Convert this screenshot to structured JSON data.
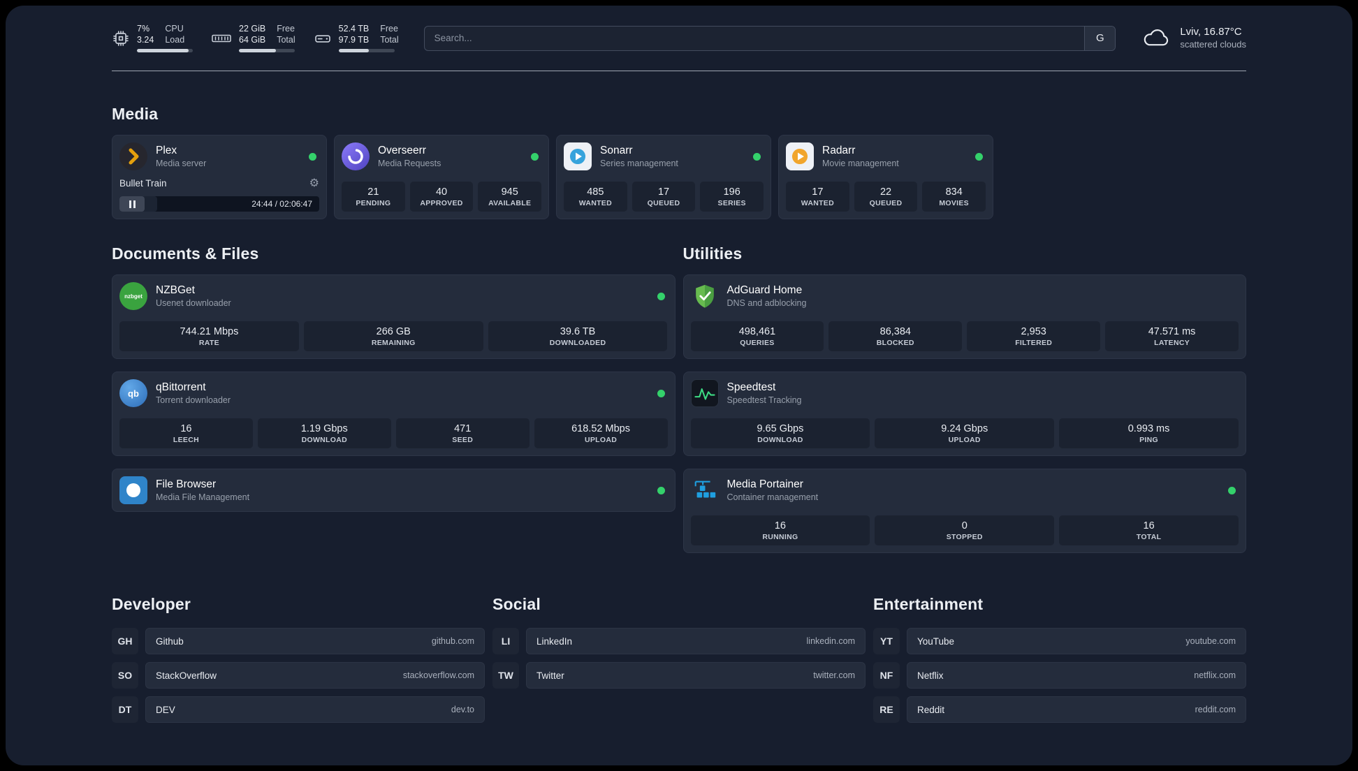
{
  "icons": {
    "gear": "⚙"
  },
  "topbar": {
    "cpu": {
      "value1": "7%",
      "value2": "3.24",
      "label1": "CPU",
      "label2": "Load",
      "bar": 93
    },
    "ram": {
      "value1": "22 GiB",
      "value2": "64 GiB",
      "label1": "Free",
      "label2": "Total",
      "bar": 66
    },
    "disk": {
      "value1": "52.4 TB",
      "value2": "97.9 TB",
      "label1": "Free",
      "label2": "Total",
      "bar": 54
    },
    "search": {
      "placeholder": "Search...",
      "engine_label": "G"
    },
    "weather": {
      "location": "Lviv, 16.87°C",
      "condition": "scattered clouds"
    }
  },
  "sections": {
    "media": {
      "title": "Media",
      "plex": {
        "name": "Plex",
        "subtitle": "Media server",
        "now_playing": "Bullet Train",
        "time": "24:44 / 02:06:47",
        "progress": 19
      },
      "overseerr": {
        "name": "Overseerr",
        "subtitle": "Media Requests",
        "stats": [
          {
            "value": "21",
            "label": "PENDING"
          },
          {
            "value": "40",
            "label": "APPROVED"
          },
          {
            "value": "945",
            "label": "AVAILABLE"
          }
        ]
      },
      "sonarr": {
        "name": "Sonarr",
        "subtitle": "Series management",
        "stats": [
          {
            "value": "485",
            "label": "WANTED"
          },
          {
            "value": "17",
            "label": "QUEUED"
          },
          {
            "value": "196",
            "label": "SERIES"
          }
        ]
      },
      "radarr": {
        "name": "Radarr",
        "subtitle": "Movie management",
        "stats": [
          {
            "value": "17",
            "label": "WANTED"
          },
          {
            "value": "22",
            "label": "QUEUED"
          },
          {
            "value": "834",
            "label": "MOVIES"
          }
        ]
      }
    },
    "documents": {
      "title": "Documents & Files",
      "nzbget": {
        "name": "NZBGet",
        "subtitle": "Usenet downloader",
        "icon_text": "nzbget",
        "stats": [
          {
            "value": "744.21 Mbps",
            "label": "RATE"
          },
          {
            "value": "266 GB",
            "label": "REMAINING"
          },
          {
            "value": "39.6 TB",
            "label": "DOWNLOADED"
          }
        ]
      },
      "qbittorrent": {
        "name": "qBittorrent",
        "subtitle": "Torrent downloader",
        "icon_text": "qb",
        "stats": [
          {
            "value": "16",
            "label": "LEECH"
          },
          {
            "value": "1.19 Gbps",
            "label": "DOWNLOAD"
          },
          {
            "value": "471",
            "label": "SEED"
          },
          {
            "value": "618.52 Mbps",
            "label": "UPLOAD"
          }
        ]
      },
      "filebrowser": {
        "name": "File Browser",
        "subtitle": "Media File Management"
      }
    },
    "utilities": {
      "title": "Utilities",
      "adguard": {
        "name": "AdGuard Home",
        "subtitle": "DNS and adblocking",
        "stats": [
          {
            "value": "498,461",
            "label": "QUERIES"
          },
          {
            "value": "86,384",
            "label": "BLOCKED"
          },
          {
            "value": "2,953",
            "label": "FILTERED"
          },
          {
            "value": "47.571 ms",
            "label": "LATENCY"
          }
        ]
      },
      "speedtest": {
        "name": "Speedtest",
        "subtitle": "Speedtest Tracking",
        "stats": [
          {
            "value": "9.65 Gbps",
            "label": "DOWNLOAD"
          },
          {
            "value": "9.24 Gbps",
            "label": "UPLOAD"
          },
          {
            "value": "0.993 ms",
            "label": "PING"
          }
        ]
      },
      "portainer": {
        "name": "Media Portainer",
        "subtitle": "Container management",
        "stats": [
          {
            "value": "16",
            "label": "RUNNING"
          },
          {
            "value": "0",
            "label": "STOPPED"
          },
          {
            "value": "16",
            "label": "TOTAL"
          }
        ]
      }
    },
    "bookmarks": [
      {
        "title": "Developer",
        "items": [
          {
            "abbr": "GH",
            "name": "Github",
            "url": "github.com"
          },
          {
            "abbr": "SO",
            "name": "StackOverflow",
            "url": "stackoverflow.com"
          },
          {
            "abbr": "DT",
            "name": "DEV",
            "url": "dev.to"
          }
        ]
      },
      {
        "title": "Social",
        "items": [
          {
            "abbr": "LI",
            "name": "LinkedIn",
            "url": "linkedin.com"
          },
          {
            "abbr": "TW",
            "name": "Twitter",
            "url": "twitter.com"
          }
        ]
      },
      {
        "title": "Entertainment",
        "items": [
          {
            "abbr": "YT",
            "name": "YouTube",
            "url": "youtube.com"
          },
          {
            "abbr": "NF",
            "name": "Netflix",
            "url": "netflix.com"
          },
          {
            "abbr": "RE",
            "name": "Reddit",
            "url": "reddit.com"
          }
        ]
      }
    ]
  },
  "colors": {
    "status_online": "#34d16b",
    "plex_gold": "#e5a00d"
  }
}
